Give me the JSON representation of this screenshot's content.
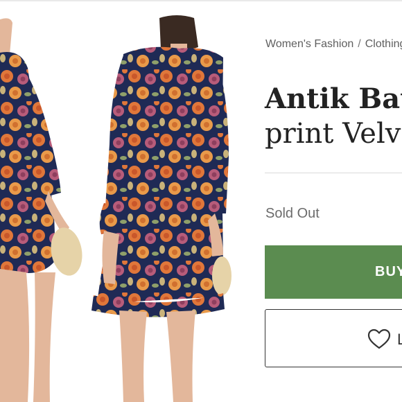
{
  "breadcrumb": {
    "items": [
      "Women's Fashion",
      "Clothing"
    ],
    "separator": "/"
  },
  "product": {
    "title_line1": "Antik Batik",
    "title_line2": "print Velvet"
  },
  "status": "Sold Out",
  "actions": {
    "buy_label": "BUY",
    "like_label": "L",
    "like_icon": "heart-icon"
  },
  "colors": {
    "buy_green": "#5b8c50",
    "dress_navy": "#1f2a55",
    "flower_orange": "#e0773a",
    "flower_pink": "#b85c7a"
  }
}
